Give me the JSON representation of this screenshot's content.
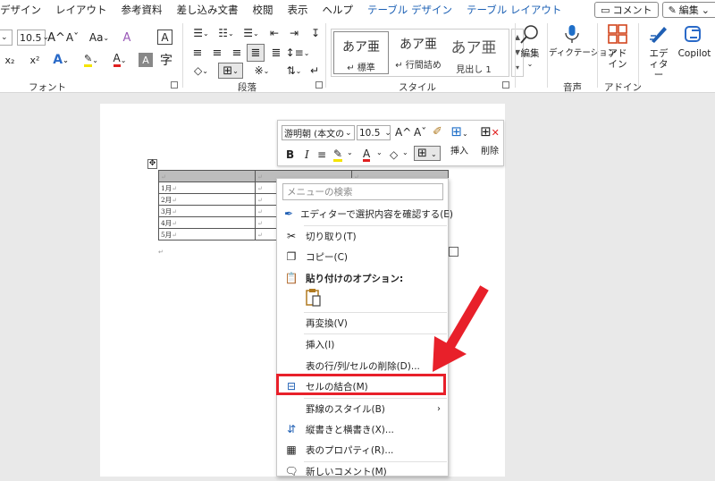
{
  "menubar": {
    "tabs": [
      "デザイン",
      "レイアウト",
      "参考資料",
      "差し込み文書",
      "校閲",
      "表示",
      "ヘルプ"
    ],
    "context_tabs": [
      "テーブル デザイン",
      "テーブル レイアウト"
    ],
    "comment_button": "コメント",
    "edit_button": "編集"
  },
  "ribbon": {
    "font_group": {
      "label": "フォント",
      "font_size": "10.5",
      "grow_font": "A^",
      "shrink_font": "Aˇ",
      "change_case": "Aa",
      "clear_format": "A",
      "subscript": "x₂",
      "superscript": "x²",
      "text_effect": "A",
      "highlight": "ab",
      "font_color": "A",
      "shading": "A",
      "border_char": "A"
    },
    "paragraph_group": {
      "label": "段落"
    },
    "style_group": {
      "label": "スタイル",
      "items": [
        {
          "sample": "あア亜",
          "name": "標準"
        },
        {
          "sample": "あア亜",
          "name": "行間詰め"
        },
        {
          "sample": "あア亜",
          "name": "見出し 1"
        }
      ]
    },
    "edit_group": {
      "label": "編集"
    },
    "voice_group": {
      "label": "音声",
      "dictation": "ディクテーション"
    },
    "addin_group": {
      "label": "アドイン",
      "addin": "アドイン"
    },
    "editor": "エディター",
    "copilot": "Copilot"
  },
  "table": {
    "rows": [
      [
        "",
        "",
        ""
      ],
      [
        "1月",
        "",
        ""
      ],
      [
        "2月",
        "",
        ""
      ],
      [
        "3月",
        "",
        ""
      ],
      [
        "4月",
        "",
        ""
      ],
      [
        "5月",
        "",
        ""
      ]
    ]
  },
  "mini_toolbar": {
    "font_name": "游明朝 (本文のフ",
    "font_size": "10.5",
    "bold": "B",
    "italic": "I",
    "insert_label": "挿入",
    "delete_label": "削除"
  },
  "context_menu": {
    "search_placeholder": "メニューの検索",
    "items": [
      {
        "label": "エディターで選択内容を確認する(E)"
      },
      {
        "label": "切り取り(T)"
      },
      {
        "label": "コピー(C)"
      },
      {
        "label": "貼り付けのオプション:"
      },
      {
        "label": "再変換(V)"
      },
      {
        "label": "挿入(I)"
      },
      {
        "label": "表の行/列/セルの削除(D)..."
      },
      {
        "label": "セルの結合(M)"
      },
      {
        "label": "罫線のスタイル(B)"
      },
      {
        "label": "縦書きと横書き(X)..."
      },
      {
        "label": "表のプロパティ(R)..."
      },
      {
        "label": "新しいコメント(M)"
      }
    ]
  },
  "colors": {
    "highlight_border": "#e8202a",
    "arrow": "#e8202a",
    "context_tab": "#1a5fb4"
  }
}
